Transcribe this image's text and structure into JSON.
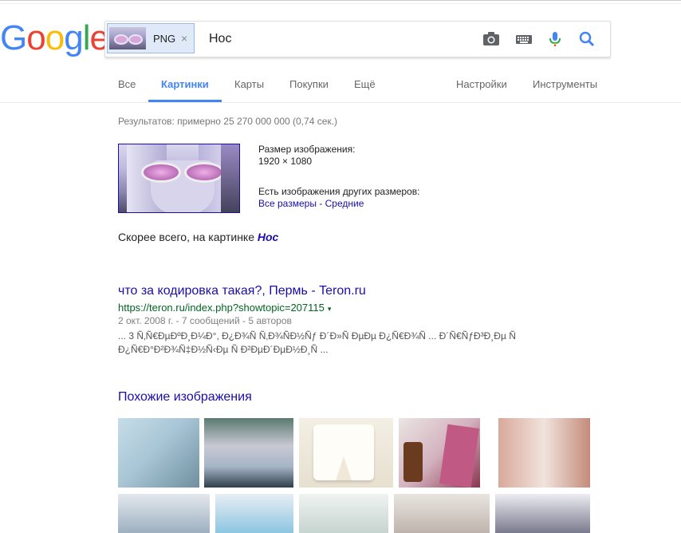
{
  "logo": {
    "letters": [
      "G",
      "o",
      "o",
      "g",
      "l",
      "e"
    ],
    "colors": [
      "#4285f4",
      "#ea4335",
      "#fbbc05",
      "#4285f4",
      "#34a853",
      "#ea4335"
    ]
  },
  "search": {
    "chip_label": "PNG",
    "chip_close": "×",
    "query": "Нос",
    "icons": [
      "camera-icon",
      "keyboard-icon",
      "microphone-icon",
      "search-icon"
    ]
  },
  "nav": {
    "tabs": [
      "Все",
      "Картинки",
      "Карты",
      "Покупки",
      "Ещё"
    ],
    "active": "Картинки",
    "right": [
      "Настройки",
      "Инструменты"
    ]
  },
  "results_count": "Результатов: примерно 25 270 000 000 (0,74 сек.)",
  "image_info": {
    "size_label": "Размер изображения:",
    "size_value": "1920 × 1080",
    "other_sizes_label": "Есть изображения других размеров:",
    "all_sizes": "Все размеры",
    "separator": " - ",
    "medium": "Средние"
  },
  "best_guess": {
    "prefix": "Скорее всего, на картинке",
    "query": "Нос"
  },
  "result": {
    "title": "что за кодировка такая?, Пермь - Teron.ru",
    "url": "https://teron.ru/index.php?showtopic=207115",
    "url_arrow": "▾",
    "meta": "2 окт. 2008 г. - 7 сообщений - 5 авторов",
    "snippet_line1": "... 3 Ñ‚Ñ€ÐµÐºÐ¸Ð¼Ð°, Ð¿Ð¾Ñ Ñ‚Ð¾ÑÐ½Ñƒ Ð´Ð»Ñ ÐµÐµ Ð¿Ñ€Ð¾Ñ ... Ð´Ñ€ÑƒÐ³Ð¸Ðµ Ñ",
    "snippet_line2": "Ð¿Ñ€Ð°Ð²Ð¾Ñ‡Ð½Ñ‹Ðµ Ñ Ð²ÐµÐ´ÐµÐ½Ð¸Ñ ..."
  },
  "similar": {
    "heading": "Похожие изображения"
  }
}
